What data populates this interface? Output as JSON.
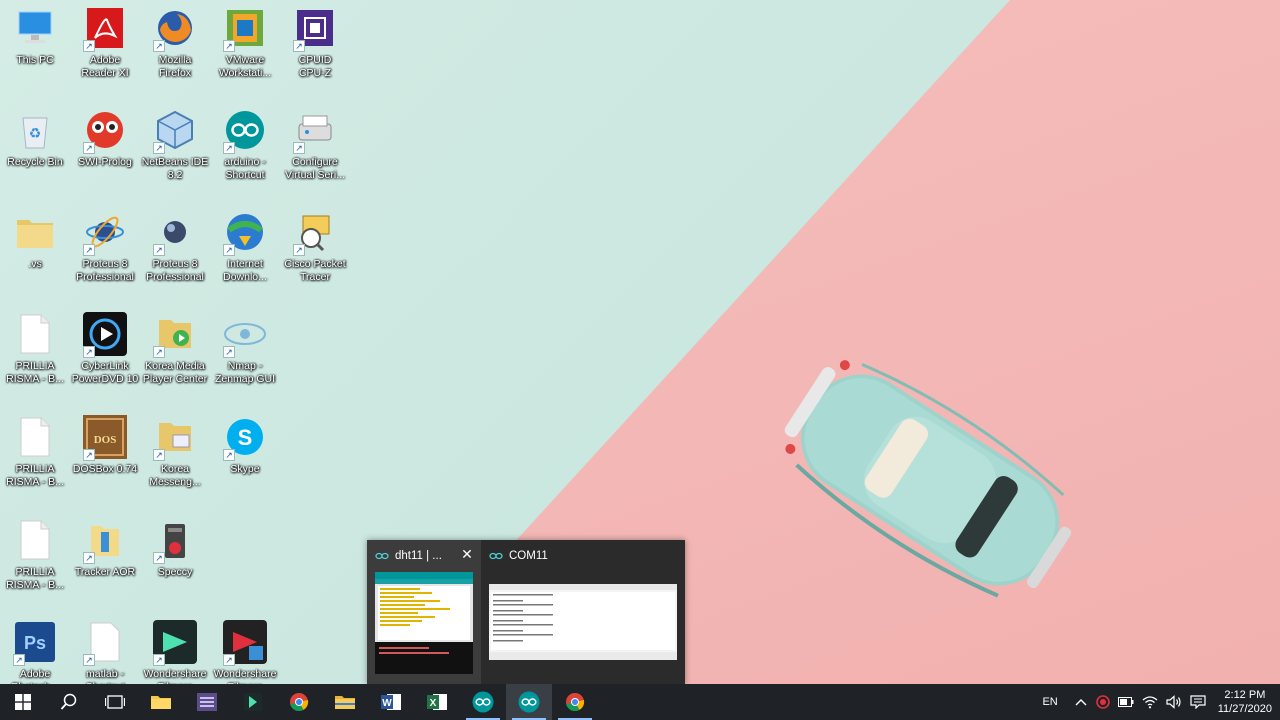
{
  "desktop": {
    "icons": [
      {
        "label": "This PC",
        "icon": "this-pc-icon"
      },
      {
        "label": "Adobe\nReader XI",
        "icon": "adobe-reader-icon"
      },
      {
        "label": "Mozilla\nFirefox",
        "icon": "firefox-icon"
      },
      {
        "label": "VMware\nWorkstati...",
        "icon": "vmware-icon"
      },
      {
        "label": "CPUID\nCPU-Z",
        "icon": "cpuz-icon"
      },
      {
        "label": "Recycle Bin",
        "icon": "recycle-bin-icon"
      },
      {
        "label": "SWI-Prolog",
        "icon": "swi-prolog-icon"
      },
      {
        "label": "NetBeans IDE\n8.2",
        "icon": "netbeans-icon"
      },
      {
        "label": "arduino -\nShortcut",
        "icon": "arduino-icon"
      },
      {
        "label": "Configure\nVirtual Seri...",
        "icon": "virtual-serial-icon"
      },
      {
        "label": ".vs",
        "icon": "folder-icon"
      },
      {
        "label": "Proteus 8\nProfessional",
        "icon": "proteus-icon"
      },
      {
        "label": "Proteus 8\nProfessional",
        "icon": "proteus-icon-2"
      },
      {
        "label": "Internet\nDownlo...",
        "icon": "idm-icon"
      },
      {
        "label": "Cisco Packet\nTracer",
        "icon": "packet-tracer-icon"
      },
      {
        "label": "PRILLIA\nRISMA - B...",
        "icon": "document-icon"
      },
      {
        "label": "CyberLink\nPowerDVD 10",
        "icon": "powerdvd-icon"
      },
      {
        "label": "Korea Media\nPlayer Center",
        "icon": "media-folder-icon"
      },
      {
        "label": "Nmap -\nZenmap GUI",
        "icon": "zenmap-icon"
      },
      {
        "label": "PRILLIA\nRISMA - B...",
        "icon": "document-icon-2"
      },
      {
        "label": "DOSBox 0.74",
        "icon": "dosbox-icon"
      },
      {
        "label": "Korea\nMesseng...",
        "icon": "messenger-folder-icon"
      },
      {
        "label": "Skype",
        "icon": "skype-icon"
      },
      {
        "label": "PRILLIA\nRISMA - B...",
        "icon": "document-icon-3"
      },
      {
        "label": "Tracker AOR",
        "icon": "tracker-icon"
      },
      {
        "label": "Speccy",
        "icon": "speccy-icon"
      },
      {
        "label": "Adobe\nPhotosh...",
        "icon": "photoshop-icon"
      },
      {
        "label": "matlab -\nShortcut",
        "icon": "matlab-icon"
      },
      {
        "label": "Wondershare\nFilmora",
        "icon": "filmora-icon"
      },
      {
        "label": "Wondershare\nFilmora",
        "icon": "filmora-icon-2"
      }
    ]
  },
  "preview": {
    "windows": [
      {
        "title": "dht11 | ...",
        "icon": "arduino-icon",
        "close": "✕"
      },
      {
        "title": "COM11",
        "icon": "arduino-icon"
      }
    ]
  },
  "taskbar": {
    "apps": [
      {
        "name": "start-button",
        "icon": "windows-icon"
      },
      {
        "name": "search-button",
        "icon": "search-icon"
      },
      {
        "name": "task-view-button",
        "icon": "task-view-icon"
      },
      {
        "name": "taskbar-file-manager",
        "icon": "folder-icon"
      },
      {
        "name": "taskbar-visual-studio",
        "icon": "visual-studio-icon"
      },
      {
        "name": "taskbar-filmora",
        "icon": "filmora-icon"
      },
      {
        "name": "taskbar-chrome",
        "icon": "chrome-icon"
      },
      {
        "name": "taskbar-explorer",
        "icon": "folder-icon"
      },
      {
        "name": "taskbar-word",
        "icon": "word-icon"
      },
      {
        "name": "taskbar-excel",
        "icon": "excel-icon"
      },
      {
        "name": "taskbar-arduino-1",
        "icon": "arduino-icon"
      },
      {
        "name": "taskbar-arduino-2",
        "icon": "arduino-icon"
      },
      {
        "name": "taskbar-chrome-2",
        "icon": "chrome-icon"
      }
    ],
    "tray": {
      "language": "EN",
      "time": "2:12 PM",
      "date": "11/27/2020"
    }
  },
  "colors": {
    "taskbar": "#1f2328",
    "wallpaper_mint": "#cfe7e1",
    "wallpaper_pink": "#f3b7b5",
    "arduino": "#00979c"
  }
}
